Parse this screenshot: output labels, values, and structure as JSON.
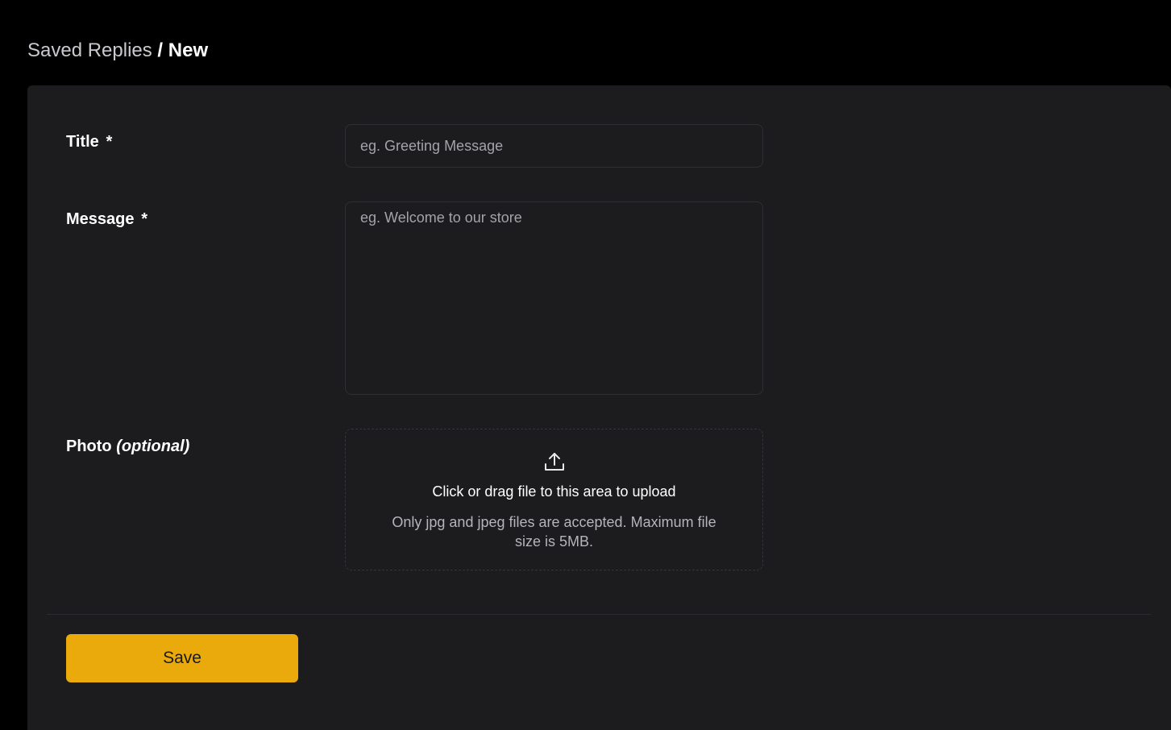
{
  "breadcrumb": {
    "parent": "Saved Replies",
    "separator": " / ",
    "current": "New"
  },
  "form": {
    "title": {
      "label": "Title",
      "required_mark": "*",
      "placeholder": "eg. Greeting Message",
      "value": ""
    },
    "message": {
      "label": "Message",
      "required_mark": "*",
      "placeholder": "eg. Welcome to our store",
      "value": ""
    },
    "photo": {
      "label": "Photo",
      "optional_text": "(optional)",
      "upload_icon": "upload-icon",
      "upload_title": "Click or drag file to this area to upload",
      "upload_hint": "Only jpg and jpeg files are accepted. Maximum file size is 5MB."
    }
  },
  "actions": {
    "save_label": "Save"
  },
  "colors": {
    "background": "#000000",
    "panel": "#1c1c1e",
    "accent": "#eaaa0c",
    "input_border": "#2f2f33"
  }
}
